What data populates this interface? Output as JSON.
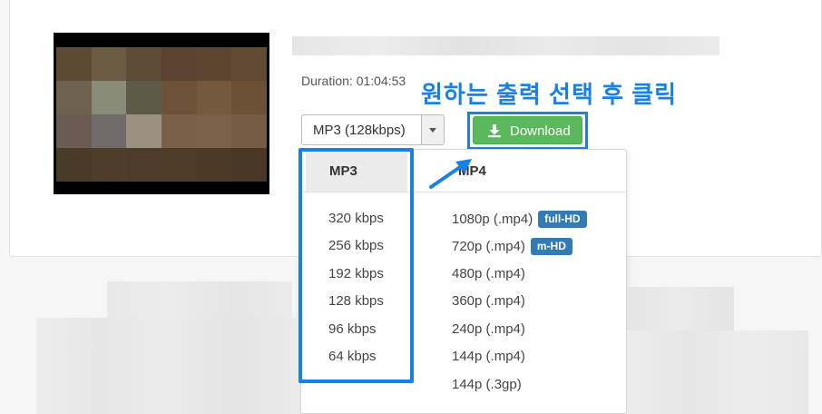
{
  "video": {
    "duration_text": "Duration: 01:04:53"
  },
  "annotation": {
    "text": "원하는 출력 선택 후 클릭",
    "color": "#1a80e6"
  },
  "format_select": {
    "selected": "MP3 (128kbps)",
    "caret_icon": "caret-down-icon"
  },
  "download_button": {
    "label": "Download",
    "icon": "download-icon",
    "color": "#5cb85c"
  },
  "dropdown": {
    "mp3": {
      "header": "MP3",
      "options": [
        "320 kbps",
        "256 kbps",
        "192 kbps",
        "128 kbps",
        "96 kbps",
        "64 kbps"
      ]
    },
    "mp4": {
      "header": "MP4",
      "options": [
        {
          "label": "1080p (.mp4)",
          "badge": "full-HD"
        },
        {
          "label": "720p (.mp4)",
          "badge": "m-HD"
        },
        {
          "label": "480p (.mp4)",
          "badge": null
        },
        {
          "label": "360p (.mp4)",
          "badge": null
        },
        {
          "label": "240p (.mp4)",
          "badge": null
        },
        {
          "label": "144p (.mp4)",
          "badge": null
        },
        {
          "label": "144p (.3gp)",
          "badge": null
        }
      ],
      "badge_color": "#337ab7"
    }
  }
}
